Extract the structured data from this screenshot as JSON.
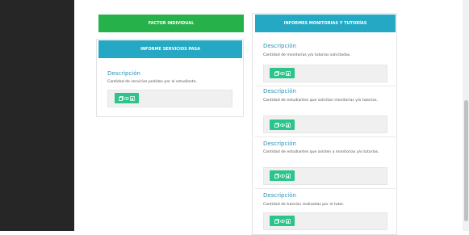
{
  "left_column": {
    "factor_button": "FACTOR INDIVIDUAL",
    "informe_header": "INFORME SERVICIOS PASA",
    "descripcion_title": "Descripción",
    "descripcion_text": "Cantidad de servicios pedidos por el estudiante."
  },
  "right_column": {
    "header": "INFORMES MONITORIAS Y TUTORÍAS",
    "items": [
      {
        "title": "Descripción",
        "text": "Cantidad de monitorias y/o tutorías solicitadas."
      },
      {
        "title": "Descripción",
        "text": "Cantidad de estudiantes que solicitan monitorias y/o tutorías."
      },
      {
        "title": "Descripción",
        "text": "Cantidad de estudiantes que asisten a monitorias y/o tutorías."
      },
      {
        "title": "Descripción",
        "text": "Cantidad de tutorías realizadas por el tutor."
      }
    ]
  },
  "icons": [
    "copy-icon",
    "eye-icon",
    "chart-icon"
  ]
}
